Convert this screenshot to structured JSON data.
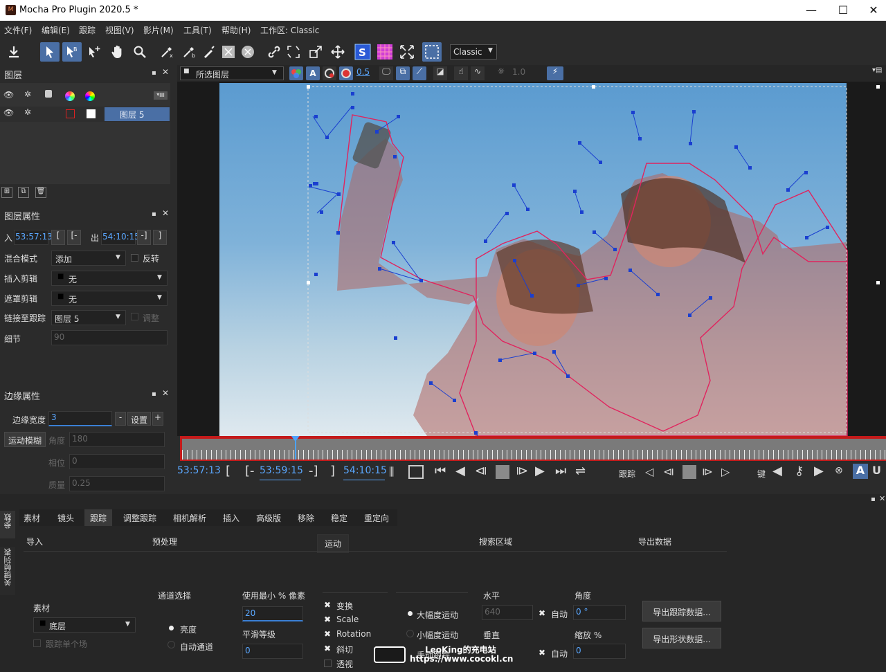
{
  "app": {
    "title": "Mocha Pro Plugin 2020.5 *",
    "icon_text": "M"
  },
  "window_controls": [
    "—",
    "☐",
    "✕"
  ],
  "menu": [
    "文件(F)",
    "编辑(E)",
    "跟踪",
    "视图(V)",
    "影片(M)",
    "工具(T)",
    "帮助(H)",
    "工作区: Classic"
  ],
  "toolbar": {
    "workspace_select": "Classic",
    "zoom_value": "0.5",
    "opacity_value": "1.0"
  },
  "layers_panel": {
    "title": "图层",
    "layer_name": "图层 5"
  },
  "viewer": {
    "layer_select": "所选图层"
  },
  "layer_props": {
    "title": "图层属性",
    "in_label": "入",
    "in_value": "53:57:13",
    "out_label": "出",
    "out_value": "54:10:15",
    "blend_label": "混合模式",
    "blend_value": "添加",
    "invert_label": "反转",
    "insert_clip_label": "插入剪辑",
    "insert_clip_value": "无",
    "matte_clip_label": "遮罩剪辑",
    "matte_clip_value": "无",
    "link_label": "链接至跟踪",
    "link_value": "图层 5",
    "adjust_label": "调整",
    "detail_label": "细节",
    "detail_value": "90"
  },
  "edge_props": {
    "title": "边缘属性",
    "width_label": "边缘宽度",
    "width_value": "3",
    "minus": "-",
    "set": "设置",
    "plus": "+",
    "motion_blur": "运动模糊",
    "angle_label": "角度",
    "angle_value": "180",
    "phase_label": "相位",
    "phase_value": "0",
    "quality_label": "质量",
    "quality_value": "0.25"
  },
  "timeline": {
    "in_time": "53:57:13",
    "current_time": "53:59:15",
    "out_time": "54:10:15",
    "track_label": "跟踪",
    "key_label": "键",
    "playhead_fraction": 0.16
  },
  "side_tabs": {
    "params": "参数",
    "keyframe_list": "关键帧列表"
  },
  "bottom_tabs": [
    "素材",
    "镜头",
    "跟踪",
    "调整跟踪",
    "相机解析",
    "插入",
    "高级版",
    "移除",
    "稳定",
    "重定向"
  ],
  "bottom_active_tab": "跟踪",
  "track_panel": {
    "sections": [
      "导入",
      "预处理",
      "运动",
      "搜索区域",
      "导出数据"
    ],
    "clip_label": "素材",
    "clip_value": "底层",
    "track_field_label": "跟踪单个场",
    "channel_label": "通道选择",
    "luminance": "亮度",
    "auto_channel": "自动通道",
    "min_pixels_label": "使用最小 % 像素",
    "min_pixels_value": "20",
    "smooth_label": "平滑等级",
    "smooth_value": "0",
    "motion_checks": [
      "变换",
      "Scale",
      "Rotation",
      "斜切",
      "透视"
    ],
    "large_motion": "大幅度运动",
    "small_motion": "小幅度运动",
    "manual_track": "手动跟踪",
    "horizontal_label": "水平",
    "horizontal_value": "640",
    "auto": "自动",
    "vertical_label": "垂直",
    "angle_label": "角度",
    "angle_value": "0 °",
    "scale_label": "缩放 %",
    "scale_value": "0",
    "export_tracking": "导出跟踪数据...",
    "export_shape": "导出形状数据..."
  },
  "watermark": {
    "line1": "LeoKing的充电站",
    "line2": "https://www.cocokl.cn"
  },
  "colors": {
    "accent": "#4a6fa5",
    "spline": "#e0245e",
    "control": "#1a3fd0",
    "timeline_red": "#c41a1a",
    "sky_top": "#5b9bd0",
    "sky_bottom": "#dfe9ef"
  }
}
